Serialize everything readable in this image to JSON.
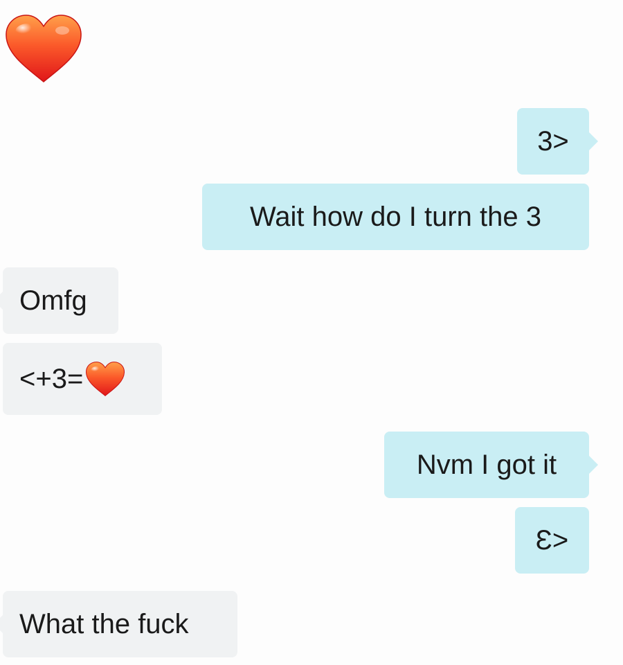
{
  "conversation": {
    "heart_emoji": "heart-emoji",
    "messages": [
      {
        "side": "sent",
        "text": "3>"
      },
      {
        "side": "sent",
        "text": "Wait how do I turn the 3"
      },
      {
        "side": "received",
        "text": "Omfg"
      },
      {
        "side": "received",
        "text": "<+3=",
        "trailing_emoji": "heart-emoji"
      },
      {
        "side": "sent",
        "text": "Nvm I got it"
      },
      {
        "side": "sent",
        "text": "Ɛ>"
      },
      {
        "side": "received",
        "text": "What the fuck"
      }
    ]
  },
  "colors": {
    "background": "#fdfdfd",
    "sent_bubble": "#c9eef4",
    "received_bubble": "#f0f2f3",
    "text": "#1a1a1a",
    "heart_top": "#ff8a3d",
    "heart_bottom": "#e6201c"
  }
}
